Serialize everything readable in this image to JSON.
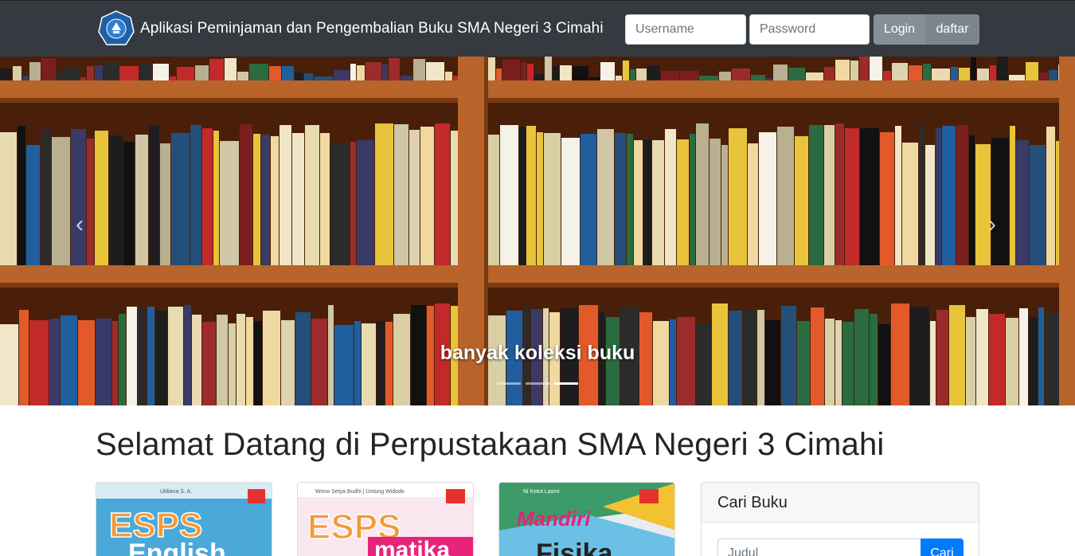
{
  "navbar": {
    "title": "Aplikasi Peminjaman dan Pengembalian Buku SMA Negeri 3 Cimahi",
    "username_placeholder": "Username",
    "password_placeholder": "Password",
    "login_label": "Login",
    "daftar_label": "daftar",
    "logo_icon": "tut-wuri-handayani-logo"
  },
  "carousel": {
    "caption": "banyak koleksi buku",
    "prev_icon": "chevron-left-icon",
    "next_icon": "chevron-right-icon",
    "active_slide": 3,
    "slide_count": 3
  },
  "main": {
    "heading": "Selamat Datang di Perpustakaan SMA Negeri 3 Cimahi",
    "books": [
      {
        "series": "ESPS",
        "subject": "English",
        "author": "Utiliana S. A."
      },
      {
        "series": "ESPS",
        "subject": "matika",
        "author": "Wono Setya Budhi | Untung Widodo"
      },
      {
        "series": "Mandiri",
        "subject": "Fisika",
        "author": "Ni Ketut Lasmi"
      }
    ],
    "search": {
      "title": "Cari Buku",
      "placeholder": "Judul",
      "button_label": "Cari"
    }
  },
  "colors": {
    "navbar_bg": "#343a40",
    "button_gray": "#868e96",
    "primary": "#007bff"
  }
}
